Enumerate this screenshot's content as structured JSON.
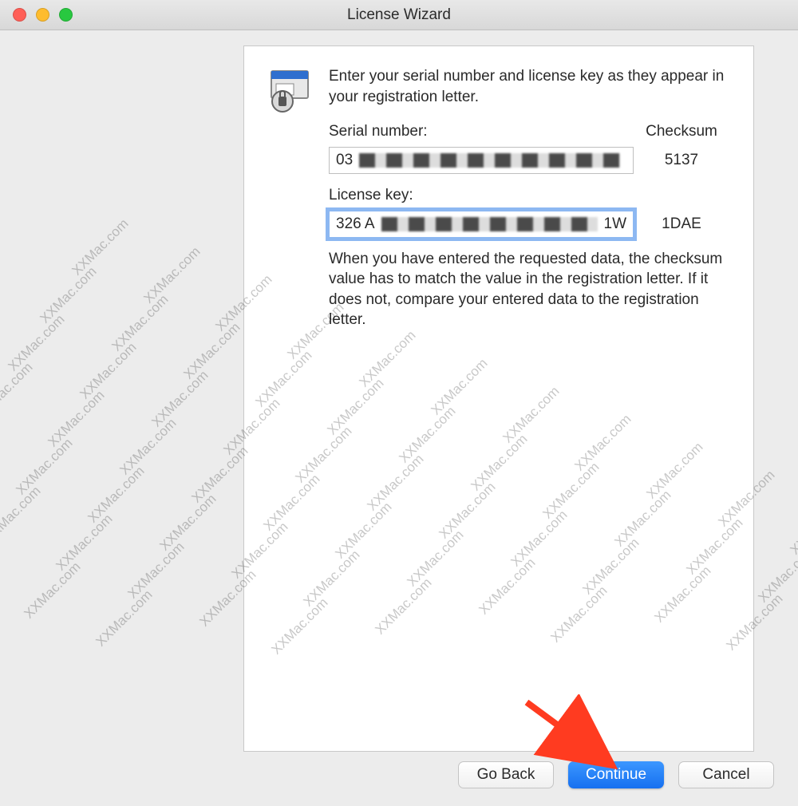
{
  "window": {
    "title": "License Wizard"
  },
  "content": {
    "instruction": "Enter your serial number and license key as they appear in your registration letter.",
    "serial_label": "Serial number:",
    "checksum_label": "Checksum",
    "serial_value_visible": "03",
    "serial_checksum": "5137",
    "license_label": "License key:",
    "license_value_visible": "326 A",
    "license_value_suffix": "1W",
    "license_checksum": "1DAE",
    "help": "When you have entered the requested data, the checksum value has to match the value in the registration letter.  If it does not, compare your entered data to the registration letter."
  },
  "buttons": {
    "go_back": "Go Back",
    "continue": "Continue",
    "cancel": "Cancel"
  },
  "watermark": "XXMac.com",
  "icons": {
    "app_icon": "license-app-icon"
  }
}
